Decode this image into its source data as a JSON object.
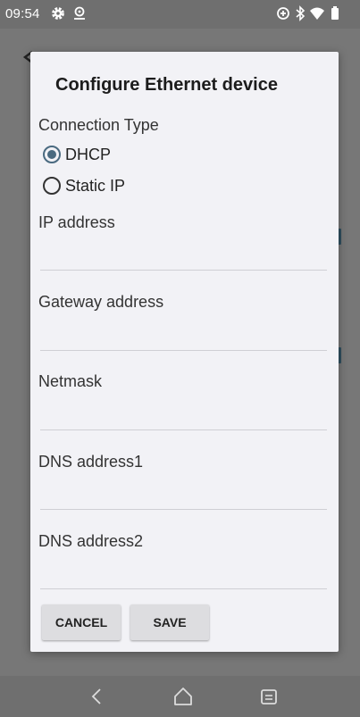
{
  "status_bar": {
    "time": "09:54",
    "icons": [
      "settings-icon",
      "location-icon",
      "data-saver-icon",
      "bluetooth-icon",
      "wifi-icon",
      "battery-icon"
    ]
  },
  "dialog": {
    "title": "Configure Ethernet device",
    "connection_type_label": "Connection Type",
    "options": [
      {
        "label": "DHCP",
        "selected": true
      },
      {
        "label": "Static IP",
        "selected": false
      }
    ],
    "fields": [
      {
        "label": "IP address",
        "value": ""
      },
      {
        "label": "Gateway address",
        "value": ""
      },
      {
        "label": "Netmask",
        "value": ""
      },
      {
        "label": "DNS address1",
        "value": ""
      },
      {
        "label": "DNS address2",
        "value": ""
      }
    ],
    "buttons": {
      "cancel": "CANCEL",
      "save": "SAVE"
    }
  },
  "nav_bar": {
    "icons": [
      "back-icon",
      "home-icon",
      "recents-icon"
    ]
  },
  "colors": {
    "accent": "#4a6a80",
    "dialog_bg": "#f2f2f6",
    "scrim": "#777777"
  }
}
